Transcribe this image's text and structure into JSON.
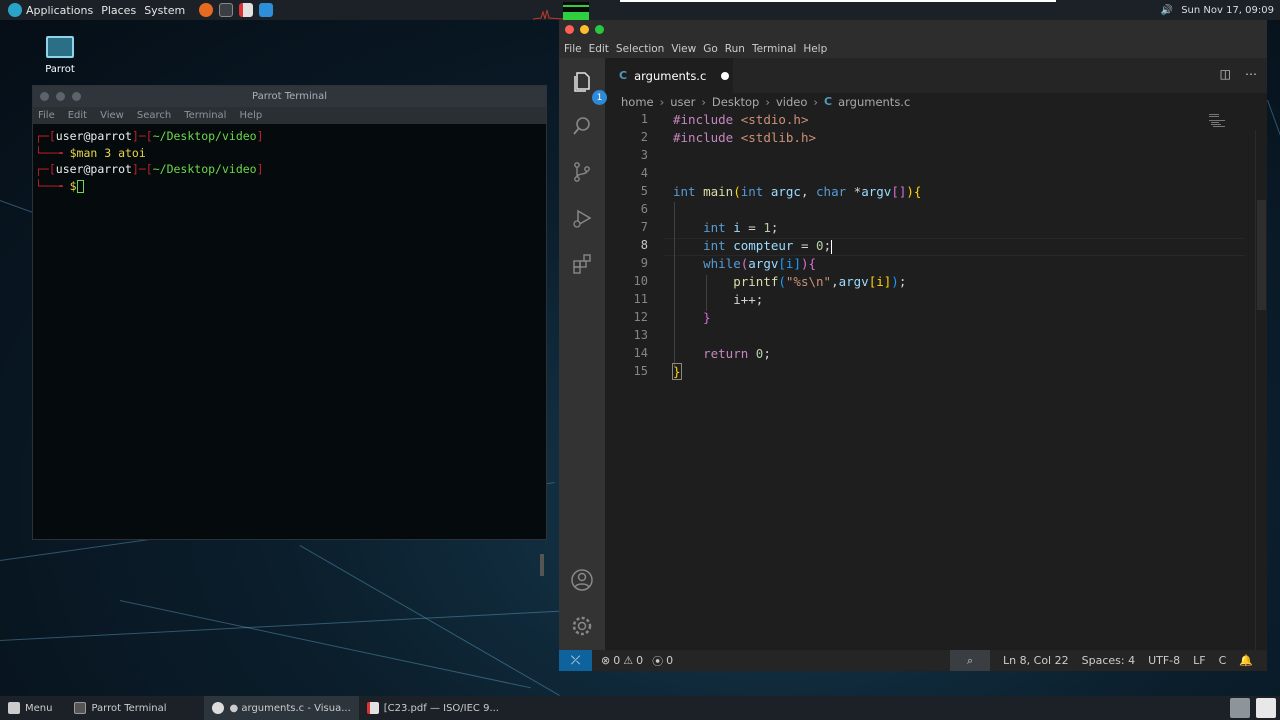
{
  "top_panel": {
    "menus": [
      "Applications",
      "Places",
      "System"
    ],
    "clock": "Sun Nov 17, 09:09",
    "launchers": [
      "firefox-icon",
      "terminal-icon",
      "pdf-icon",
      "vscode-icon"
    ]
  },
  "desktop": {
    "icon_label": "Parrot"
  },
  "terminal": {
    "title": "Parrot Terminal",
    "menu": [
      "File",
      "Edit",
      "View",
      "Search",
      "Terminal",
      "Help"
    ],
    "lines": [
      {
        "user": "user@parrot",
        "path": "~/Desktop/video"
      },
      {
        "cmd": "$man 3 atoi"
      },
      {
        "user": "user@parrot",
        "path": "~/Desktop/video"
      },
      {
        "cmd": "$"
      }
    ]
  },
  "vscode": {
    "menu": [
      "File",
      "Edit",
      "Selection",
      "View",
      "Go",
      "Run",
      "Terminal",
      "Help"
    ],
    "tab": {
      "icon_letter": "C",
      "label": "arguments.c"
    },
    "breadcrumb": [
      "home",
      "user",
      "Desktop",
      "video",
      "arguments.c"
    ],
    "badge_count": "1",
    "line_numbers": [
      "1",
      "2",
      "3",
      "4",
      "5",
      "6",
      "7",
      "8",
      "9",
      "10",
      "11",
      "12",
      "13",
      "14",
      "15"
    ],
    "current_line": "8",
    "code": {
      "l1_dir": "#include",
      "l1_hdr": "<stdio.h>",
      "l2_dir": "#include",
      "l2_hdr": "<stdlib.h>",
      "l5_type": "int",
      "l5_fn": "main",
      "l5_open": "(",
      "l5_t1": "int",
      "l5_p1": "argc",
      "l5_comma": ",",
      "l5_t2": "char",
      "l5_star": "*",
      "l5_p2": "argv",
      "l5_arr": "[]",
      "l5_close": ")",
      "l5_brace": "{",
      "l7_type": "int",
      "l7_var": "i",
      "l7_eq": "=",
      "l7_num": "1",
      "l7_semi": ";",
      "l8_type": "int",
      "l8_var": "compteur",
      "l8_eq": "=",
      "l8_num": "0",
      "l8_semi": ";",
      "l9_kw": "while",
      "l9_open": "(",
      "l9_var": "argv",
      "l9_idx": "[i]",
      "l9_close": ")",
      "l9_brace": "{",
      "l10_fn": "printf",
      "l10_open": "(",
      "l10_str": "\"%s\\n\"",
      "l10_comma": ",",
      "l10_var": "argv",
      "l10_idx": "[i]",
      "l10_close": ")",
      "l10_semi": ";",
      "l11": "i++;",
      "l12_brace": "}",
      "l14_kw": "return",
      "l14_num": "0",
      "l14_semi": ";",
      "l15_brace": "}"
    },
    "status": {
      "errors": "0",
      "warnings": "0",
      "ports": "0",
      "position": "Ln 8, Col 22",
      "spaces": "Spaces: 4",
      "encoding": "UTF-8",
      "eol": "LF",
      "language": "C"
    }
  },
  "taskbar": {
    "menu_label": "Menu",
    "tasks": [
      "Parrot Terminal",
      "● arguments.c - Visua...",
      "[C23.pdf — ISO/IEC 9..."
    ]
  }
}
